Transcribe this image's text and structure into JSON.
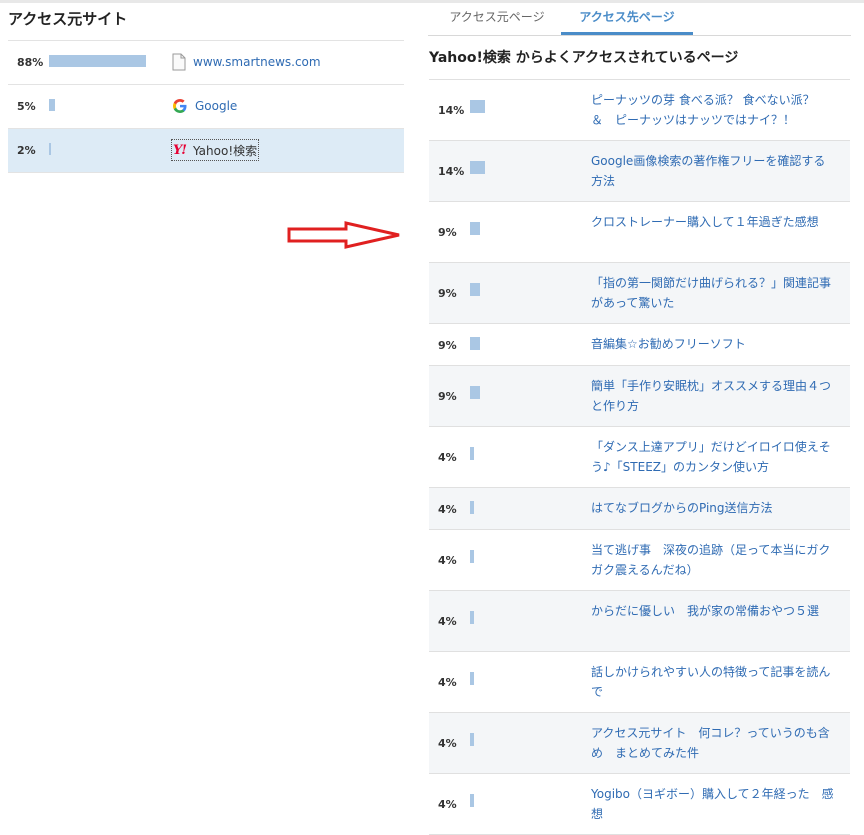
{
  "left_panel": {
    "title": "アクセス元サイト",
    "sources": [
      {
        "percent": "88%",
        "bar_fraction": 0.88,
        "icon": "file-icon",
        "name": "www.smartnews.com"
      },
      {
        "percent": "5%",
        "bar_fraction": 0.05,
        "icon": "google-icon",
        "name": "Google"
      },
      {
        "percent": "2%",
        "bar_fraction": 0.02,
        "icon": "yahoo-icon",
        "name": "Yahoo!検索",
        "selected": true
      }
    ]
  },
  "annotation": {
    "arrow_icon": "red-right-arrow-icon",
    "arrow_color": "#e02020"
  },
  "right_panel": {
    "tabs": [
      {
        "label": "アクセス元ページ",
        "active": false
      },
      {
        "label": "アクセス先ページ",
        "active": true
      }
    ],
    "title": "Yahoo!検索 からよくアクセスされているページ",
    "pages": [
      {
        "percent": "14%",
        "bar_fraction": 0.14,
        "title": "ピーナッツの芽 食べる派？ 食べない派？　＆　ピーナッツはナッツではナイ？！"
      },
      {
        "percent": "14%",
        "bar_fraction": 0.14,
        "title": "Google画像検索の著作権フリーを確認する方法"
      },
      {
        "percent": "9%",
        "bar_fraction": 0.09,
        "title": "クロストレーナー購入して１年過ぎた感想"
      },
      {
        "percent": "9%",
        "bar_fraction": 0.09,
        "title": "「指の第一関節だけ曲げられる？」関連記事があって驚いた"
      },
      {
        "percent": "9%",
        "bar_fraction": 0.09,
        "title": "音編集☆お勧めフリーソフト"
      },
      {
        "percent": "9%",
        "bar_fraction": 0.09,
        "title": "簡単「手作り安眠枕」オススメする理由４つと作り方"
      },
      {
        "percent": "4%",
        "bar_fraction": 0.04,
        "title": "「ダンス上達アプリ」だけどイロイロ使えそう♪「STEEZ」のカンタン使い方"
      },
      {
        "percent": "4%",
        "bar_fraction": 0.04,
        "title": "はてなブログからのPing送信方法"
      },
      {
        "percent": "4%",
        "bar_fraction": 0.04,
        "title": "当て逃げ事　深夜の追跡（足って本当にガクガク震えるんだね）"
      },
      {
        "percent": "4%",
        "bar_fraction": 0.04,
        "title": "からだに優しい　我が家の常備おやつ５選"
      },
      {
        "percent": "4%",
        "bar_fraction": 0.04,
        "title": "話しかけられやすい人の特徴って記事を読んで"
      },
      {
        "percent": "4%",
        "bar_fraction": 0.04,
        "title": "アクセス元サイト　何コレ？っていうのも含め　まとめてみた件"
      },
      {
        "percent": "4%",
        "bar_fraction": 0.04,
        "title": "Yogibo（ヨギボー）購入して２年経った　感想"
      }
    ]
  },
  "colors": {
    "link": "#2f6bb3",
    "bar": "#aac7e4",
    "selected_row": "#ddebf6",
    "active_tab": "#4a8cc8"
  }
}
